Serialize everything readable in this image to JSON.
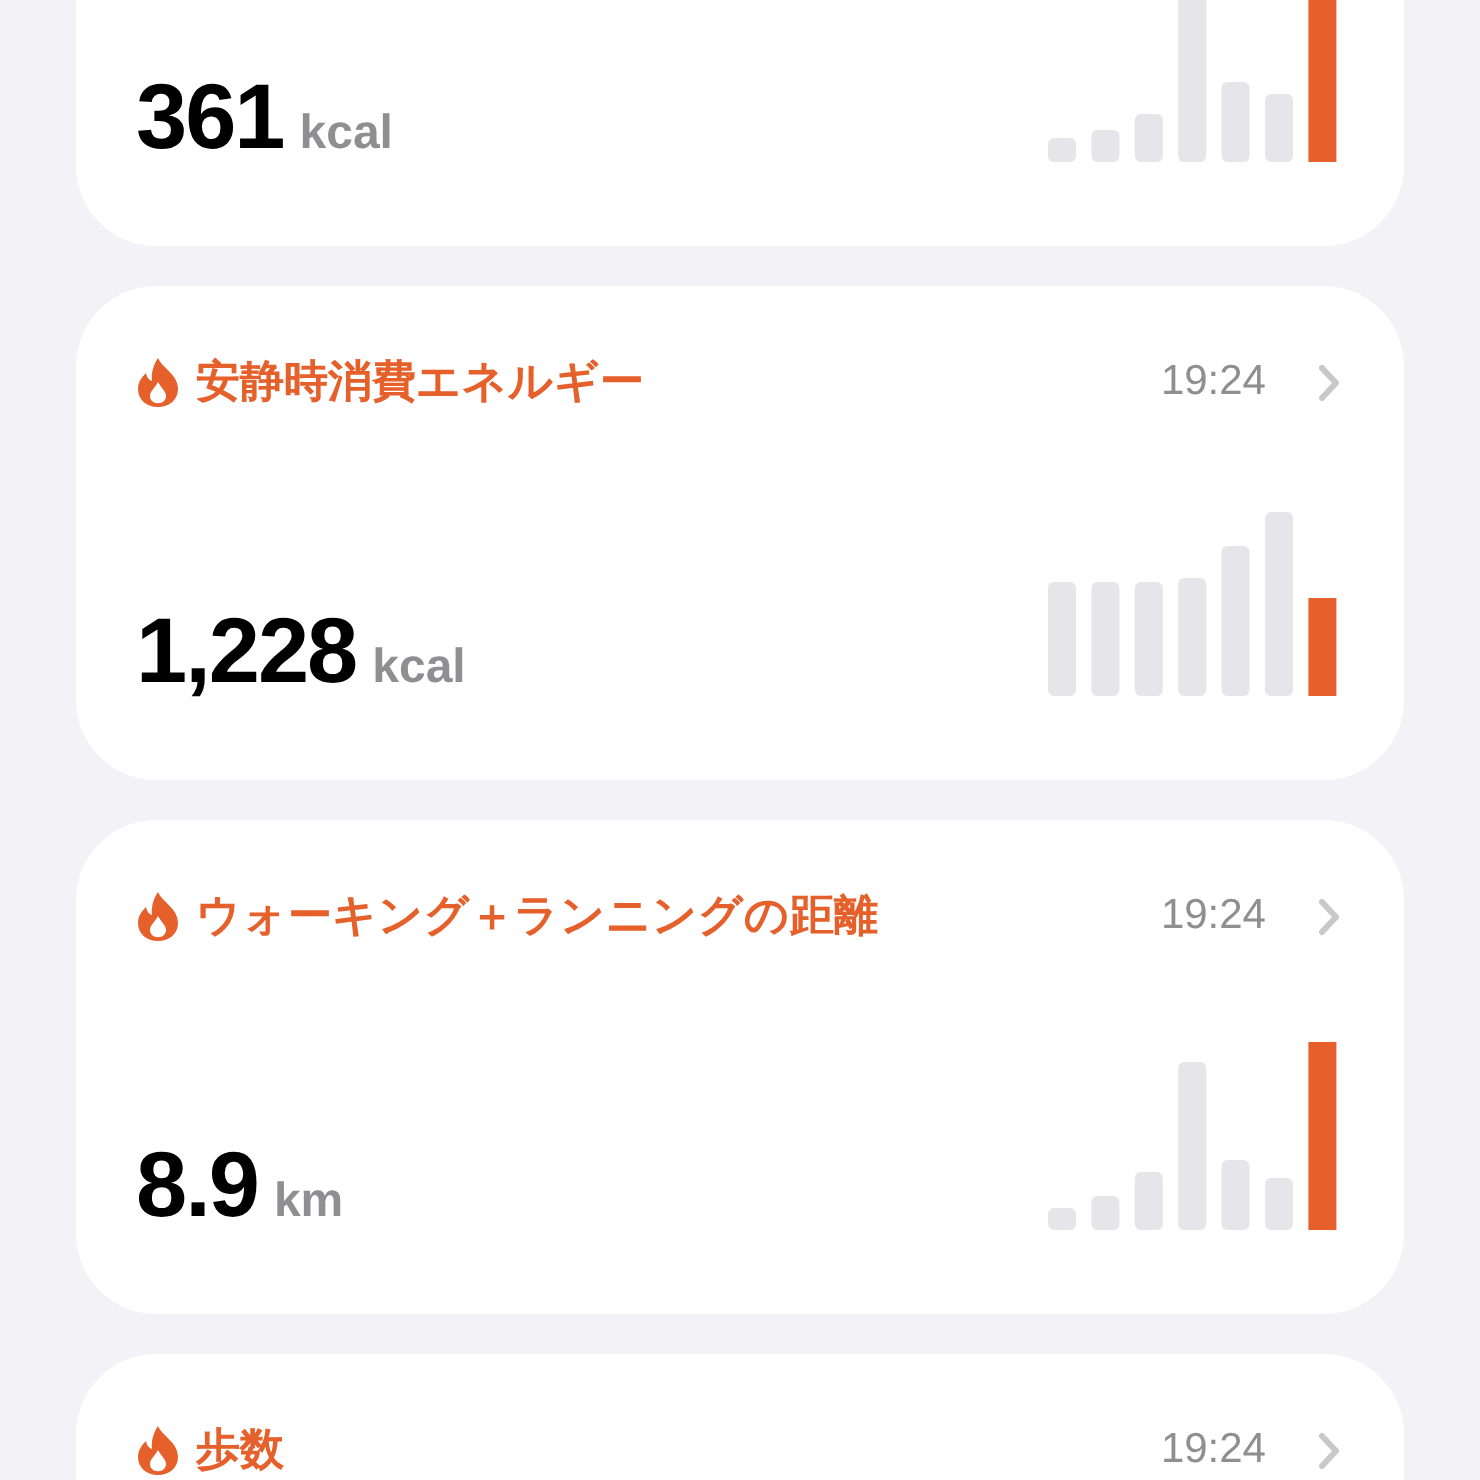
{
  "cards": [
    {
      "value": "361",
      "unit": "kcal"
    },
    {
      "title": "安静時消費エネルギー",
      "time": "19:24",
      "value": "1,228",
      "unit": "kcal"
    },
    {
      "title": "ウォーキング＋ランニングの距離",
      "time": "19:24",
      "value": "8.9",
      "unit": "km"
    },
    {
      "title": "歩数",
      "time": "19:24"
    }
  ]
}
